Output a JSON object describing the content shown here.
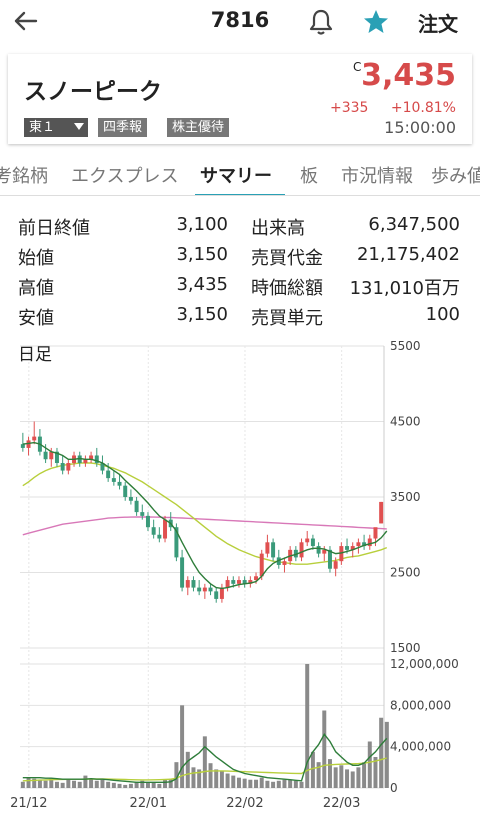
{
  "header": {
    "code": "7816",
    "order_label": "注文"
  },
  "stock": {
    "name": "スノーピーク",
    "market": "東１",
    "tag_quarterly": "四季報",
    "tag_yutai": "株主優待",
    "c_flag": "C",
    "price": "3,435",
    "change": "+335",
    "change_pct": "+10.81%",
    "time": "15:00:00",
    "up_color": "#d64a4a"
  },
  "tabs": [
    "考銘柄",
    "エクスプレス",
    "サマリー",
    "板",
    "市況情報",
    "歩み値"
  ],
  "active_tab": "サマリー",
  "stats": [
    {
      "k1": "前日終値",
      "v1": "3,100",
      "k2": "出来高",
      "v2": "6,347,500"
    },
    {
      "k1": "始値",
      "v1": "3,150",
      "k2": "売買代金",
      "v2": "21,175,402"
    },
    {
      "k1": "高値",
      "v1": "3,435",
      "k2": "時価総額",
      "v2": "131,010百万"
    },
    {
      "k1": "安値",
      "v1": "3,150",
      "k2": "売買単元",
      "v2": "100"
    }
  ],
  "chart_label": "日足",
  "chart_data": {
    "type": "candlestick",
    "price_axis": {
      "ticks": [
        5500,
        4500,
        3500,
        2500,
        1500
      ],
      "ylim": [
        1500,
        5500
      ]
    },
    "volume_axis": {
      "labels": [
        "12,000,000",
        "8,000,000",
        "4,000,000",
        "0"
      ],
      "ticks": [
        12000000,
        8000000,
        4000000,
        0
      ]
    },
    "x_labels": [
      "21/12",
      "22/01",
      "22/02",
      "22/03"
    ],
    "candles": [
      {
        "o": 4200,
        "h": 4350,
        "l": 4100,
        "c": 4150
      },
      {
        "o": 4150,
        "h": 4300,
        "l": 4050,
        "c": 4250
      },
      {
        "o": 4250,
        "h": 4500,
        "l": 4200,
        "c": 4300
      },
      {
        "o": 4300,
        "h": 4400,
        "l": 4050,
        "c": 4100
      },
      {
        "o": 4100,
        "h": 4200,
        "l": 3950,
        "c": 4000
      },
      {
        "o": 4000,
        "h": 4150,
        "l": 3900,
        "c": 4100
      },
      {
        "o": 4100,
        "h": 4150,
        "l": 3900,
        "c": 3950
      },
      {
        "o": 3950,
        "h": 4050,
        "l": 3800,
        "c": 3850
      },
      {
        "o": 3850,
        "h": 4000,
        "l": 3800,
        "c": 3950
      },
      {
        "o": 3950,
        "h": 4100,
        "l": 3900,
        "c": 4050
      },
      {
        "o": 4050,
        "h": 4100,
        "l": 3900,
        "c": 3950
      },
      {
        "o": 3950,
        "h": 4050,
        "l": 3900,
        "c": 4000
      },
      {
        "o": 4000,
        "h": 4100,
        "l": 3950,
        "c": 4050
      },
      {
        "o": 4050,
        "h": 4150,
        "l": 3900,
        "c": 3950
      },
      {
        "o": 3950,
        "h": 4050,
        "l": 3800,
        "c": 3850
      },
      {
        "o": 3850,
        "h": 3950,
        "l": 3700,
        "c": 3750
      },
      {
        "o": 3750,
        "h": 3850,
        "l": 3650,
        "c": 3700
      },
      {
        "o": 3700,
        "h": 3800,
        "l": 3600,
        "c": 3650
      },
      {
        "o": 3650,
        "h": 3700,
        "l": 3450,
        "c": 3500
      },
      {
        "o": 3500,
        "h": 3600,
        "l": 3400,
        "c": 3450
      },
      {
        "o": 3450,
        "h": 3500,
        "l": 3250,
        "c": 3300
      },
      {
        "o": 3300,
        "h": 3400,
        "l": 3200,
        "c": 3250
      },
      {
        "o": 3250,
        "h": 3300,
        "l": 3050,
        "c": 3100
      },
      {
        "o": 3100,
        "h": 3200,
        "l": 2950,
        "c": 3000
      },
      {
        "o": 3000,
        "h": 3100,
        "l": 2900,
        "c": 2950
      },
      {
        "o": 2950,
        "h": 3250,
        "l": 2900,
        "c": 3200
      },
      {
        "o": 3200,
        "h": 3300,
        "l": 3050,
        "c": 3100
      },
      {
        "o": 3100,
        "h": 3150,
        "l": 2650,
        "c": 2700
      },
      {
        "o": 2700,
        "h": 2800,
        "l": 2250,
        "c": 2300
      },
      {
        "o": 2300,
        "h": 2450,
        "l": 2200,
        "c": 2400
      },
      {
        "o": 2400,
        "h": 2450,
        "l": 2250,
        "c": 2300
      },
      {
        "o": 2300,
        "h": 2400,
        "l": 2200,
        "c": 2250
      },
      {
        "o": 2250,
        "h": 2350,
        "l": 2150,
        "c": 2300
      },
      {
        "o": 2300,
        "h": 2350,
        "l": 2200,
        "c": 2250
      },
      {
        "o": 2250,
        "h": 2300,
        "l": 2100,
        "c": 2150
      },
      {
        "o": 2150,
        "h": 2350,
        "l": 2100,
        "c": 2300
      },
      {
        "o": 2300,
        "h": 2450,
        "l": 2250,
        "c": 2400
      },
      {
        "o": 2400,
        "h": 2450,
        "l": 2300,
        "c": 2350
      },
      {
        "o": 2350,
        "h": 2450,
        "l": 2300,
        "c": 2400
      },
      {
        "o": 2400,
        "h": 2450,
        "l": 2300,
        "c": 2350
      },
      {
        "o": 2350,
        "h": 2450,
        "l": 2300,
        "c": 2400
      },
      {
        "o": 2400,
        "h": 2500,
        "l": 2350,
        "c": 2450
      },
      {
        "o": 2450,
        "h": 2800,
        "l": 2400,
        "c": 2750
      },
      {
        "o": 2750,
        "h": 3000,
        "l": 2700,
        "c": 2900
      },
      {
        "o": 2900,
        "h": 2950,
        "l": 2650,
        "c": 2700
      },
      {
        "o": 2700,
        "h": 2800,
        "l": 2550,
        "c": 2600
      },
      {
        "o": 2600,
        "h": 2700,
        "l": 2500,
        "c": 2650
      },
      {
        "o": 2650,
        "h": 2850,
        "l": 2600,
        "c": 2800
      },
      {
        "o": 2800,
        "h": 2850,
        "l": 2650,
        "c": 2700
      },
      {
        "o": 2700,
        "h": 2950,
        "l": 2650,
        "c": 2900
      },
      {
        "o": 2900,
        "h": 3050,
        "l": 2850,
        "c": 2950
      },
      {
        "o": 2950,
        "h": 3000,
        "l": 2800,
        "c": 2850
      },
      {
        "o": 2850,
        "h": 2900,
        "l": 2700,
        "c": 2750
      },
      {
        "o": 2750,
        "h": 2850,
        "l": 2650,
        "c": 2800
      },
      {
        "o": 2800,
        "h": 2850,
        "l": 2500,
        "c": 2550
      },
      {
        "o": 2550,
        "h": 2700,
        "l": 2450,
        "c": 2650
      },
      {
        "o": 2650,
        "h": 2900,
        "l": 2600,
        "c": 2850
      },
      {
        "o": 2850,
        "h": 2950,
        "l": 2750,
        "c": 2800
      },
      {
        "o": 2800,
        "h": 2900,
        "l": 2700,
        "c": 2850
      },
      {
        "o": 2850,
        "h": 2950,
        "l": 2750,
        "c": 2900
      },
      {
        "o": 2900,
        "h": 3000,
        "l": 2800,
        "c": 2850
      },
      {
        "o": 2850,
        "h": 3000,
        "l": 2800,
        "c": 2950
      },
      {
        "o": 2950,
        "h": 3050,
        "l": 2850,
        "c": 3100
      },
      {
        "o": 3150,
        "h": 3435,
        "l": 3150,
        "c": 3435
      }
    ],
    "ma_short": [
      4200,
      4210,
      4220,
      4200,
      4150,
      4100,
      4080,
      4050,
      4000,
      4000,
      4010,
      4000,
      4000,
      3980,
      3950,
      3900,
      3850,
      3800,
      3720,
      3650,
      3580,
      3500,
      3420,
      3330,
      3250,
      3200,
      3150,
      3050,
      2900,
      2760,
      2620,
      2500,
      2420,
      2350,
      2300,
      2290,
      2300,
      2320,
      2340,
      2350,
      2360,
      2380,
      2450,
      2550,
      2620,
      2660,
      2690,
      2720,
      2740,
      2770,
      2800,
      2820,
      2820,
      2810,
      2780,
      2750,
      2760,
      2780,
      2800,
      2830,
      2860,
      2880,
      2900,
      2960,
      3050
    ],
    "ma_mid": [
      3650,
      3700,
      3760,
      3810,
      3850,
      3880,
      3900,
      3920,
      3930,
      3940,
      3950,
      3950,
      3950,
      3940,
      3920,
      3900,
      3880,
      3850,
      3820,
      3780,
      3740,
      3700,
      3650,
      3600,
      3550,
      3500,
      3450,
      3400,
      3340,
      3280,
      3220,
      3160,
      3100,
      3040,
      2980,
      2930,
      2880,
      2840,
      2800,
      2770,
      2740,
      2710,
      2690,
      2670,
      2650,
      2640,
      2630,
      2620,
      2610,
      2610,
      2610,
      2620,
      2630,
      2640,
      2650,
      2660,
      2680,
      2700,
      2710,
      2720,
      2740,
      2760,
      2780,
      2800,
      2830
    ],
    "ma_long": [
      3000,
      3020,
      3040,
      3060,
      3080,
      3100,
      3120,
      3140,
      3150,
      3160,
      3170,
      3180,
      3190,
      3200,
      3210,
      3220,
      3225,
      3230,
      3232,
      3234,
      3235,
      3235,
      3235,
      3234,
      3232,
      3230,
      3228,
      3225,
      3222,
      3218,
      3214,
      3210,
      3206,
      3202,
      3198,
      3194,
      3190,
      3186,
      3182,
      3178,
      3174,
      3170,
      3166,
      3162,
      3158,
      3154,
      3150,
      3146,
      3142,
      3138,
      3134,
      3130,
      3126,
      3122,
      3118,
      3114,
      3110,
      3106,
      3102,
      3098,
      3094,
      3090,
      3086,
      3082,
      3078
    ],
    "volumes": [
      600000,
      1000000,
      900000,
      800000,
      700000,
      900000,
      600000,
      500000,
      800000,
      700000,
      600000,
      1200000,
      900000,
      700000,
      800000,
      600000,
      500000,
      400000,
      300000,
      400000,
      600000,
      700000,
      500000,
      500000,
      400000,
      800000,
      900000,
      2500000,
      8000000,
      3500000,
      2000000,
      1800000,
      5000000,
      2400000,
      1800000,
      1600000,
      1400000,
      1200000,
      1000000,
      900000,
      800000,
      800000,
      1000000,
      700000,
      600000,
      700000,
      800000,
      800000,
      700000,
      600000,
      12000000,
      3500000,
      2500000,
      7500000,
      2800000,
      2000000,
      2200000,
      1800000,
      1600000,
      2000000,
      2500000,
      4500000,
      3000000,
      6800000,
      6400000
    ],
    "vol_ma_short": [
      1000000,
      1000000,
      1000000,
      1000000,
      950000,
      950000,
      900000,
      850000,
      850000,
      850000,
      850000,
      850000,
      900000,
      850000,
      850000,
      800000,
      750000,
      700000,
      650000,
      600000,
      550000,
      550000,
      550000,
      550000,
      550000,
      550000,
      600000,
      900000,
      2000000,
      2600000,
      3000000,
      3400000,
      4000000,
      3500000,
      3000000,
      2600000,
      2200000,
      1800000,
      1600000,
      1400000,
      1300000,
      1200000,
      1100000,
      1000000,
      950000,
      900000,
      850000,
      800000,
      750000,
      700000,
      2500000,
      3500000,
      4200000,
      5200000,
      4500000,
      3500000,
      3000000,
      2500000,
      2200000,
      2200000,
      2400000,
      3000000,
      3500000,
      4200000,
      4800000
    ],
    "vol_ma_long": [
      700000,
      720000,
      740000,
      760000,
      780000,
      800000,
      820000,
      830000,
      840000,
      850000,
      850000,
      860000,
      870000,
      870000,
      870000,
      860000,
      850000,
      840000,
      820000,
      800000,
      790000,
      780000,
      780000,
      790000,
      800000,
      820000,
      850000,
      950000,
      1200000,
      1350000,
      1450000,
      1500000,
      1600000,
      1650000,
      1650000,
      1650000,
      1640000,
      1620000,
      1600000,
      1580000,
      1560000,
      1540000,
      1520000,
      1500000,
      1480000,
      1460000,
      1440000,
      1420000,
      1410000,
      1400000,
      1700000,
      1900000,
      2000000,
      2200000,
      2250000,
      2280000,
      2300000,
      2320000,
      2340000,
      2360000,
      2400000,
      2500000,
      2600000,
      2750000,
      2900000
    ]
  }
}
